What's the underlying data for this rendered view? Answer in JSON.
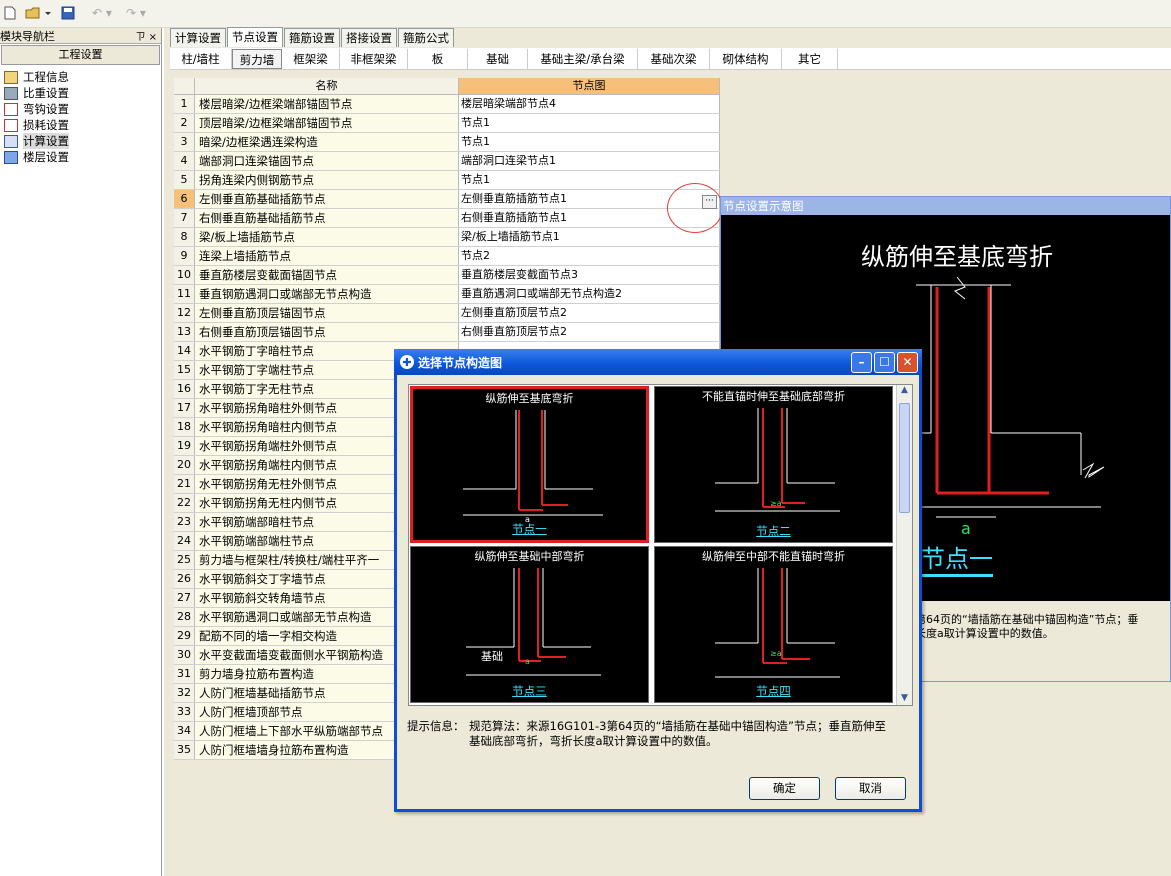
{
  "toolbar": {
    "icons": [
      "new-file-icon",
      "open-folder-icon",
      "save-icon",
      "undo-icon",
      "redo-icon"
    ]
  },
  "nav": {
    "title": "模块导航栏",
    "pin": "ㄗ ×",
    "section": "工程设置",
    "items": [
      {
        "label": "工程信息"
      },
      {
        "label": "比重设置"
      },
      {
        "label": "弯钩设置"
      },
      {
        "label": "损耗设置"
      },
      {
        "label": "计算设置"
      },
      {
        "label": "楼层设置"
      }
    ]
  },
  "tabs": [
    "计算设置",
    "节点设置",
    "箍筋设置",
    "搭接设置",
    "箍筋公式"
  ],
  "subtabs": [
    "柱/墙柱",
    "剪力墙",
    "框架梁",
    "非框架梁",
    "板",
    "基础",
    "基础主梁/承台梁",
    "基础次梁",
    "砌体结构",
    "其它"
  ],
  "grid": {
    "col_name": "名称",
    "col_value": "节点图",
    "rows": [
      {
        "n": "1",
        "name": "楼层暗梁/边框梁端部锚固节点",
        "value": "楼层暗梁端部节点4"
      },
      {
        "n": "2",
        "name": "顶层暗梁/边框梁端部锚固节点",
        "value": "节点1"
      },
      {
        "n": "3",
        "name": "暗梁/边框梁遇连梁构造",
        "value": "节点1"
      },
      {
        "n": "4",
        "name": "端部洞口连梁锚固节点",
        "value": "端部洞口连梁节点1"
      },
      {
        "n": "5",
        "name": "拐角连梁内侧钢筋节点",
        "value": "节点1"
      },
      {
        "n": "6",
        "name": "左侧垂直筋基础插筋节点",
        "value": "左侧垂直筋插筋节点1"
      },
      {
        "n": "7",
        "name": "右侧垂直筋基础插筋节点",
        "value": "右侧垂直筋插筋节点1"
      },
      {
        "n": "8",
        "name": "梁/板上墙插筋节点",
        "value": "梁/板上墙插筋节点1"
      },
      {
        "n": "9",
        "name": "连梁上墙插筋节点",
        "value": "节点2"
      },
      {
        "n": "10",
        "name": "垂直筋楼层变截面锚固节点",
        "value": "垂直筋楼层变截面节点3"
      },
      {
        "n": "11",
        "name": "垂直钢筋遇洞口或端部无节点构造",
        "value": "垂直筋遇洞口或端部无节点构造2"
      },
      {
        "n": "12",
        "name": "左侧垂直筋顶层锚固节点",
        "value": "左侧垂直筋顶层节点2"
      },
      {
        "n": "13",
        "name": "右侧垂直筋顶层锚固节点",
        "value": "右侧垂直筋顶层节点2"
      },
      {
        "n": "14",
        "name": "水平钢筋丁字暗柱节点",
        "value": ""
      },
      {
        "n": "15",
        "name": "水平钢筋丁字端柱节点",
        "value": ""
      },
      {
        "n": "16",
        "name": "水平钢筋丁字无柱节点",
        "value": ""
      },
      {
        "n": "17",
        "name": "水平钢筋拐角暗柱外侧节点",
        "value": ""
      },
      {
        "n": "18",
        "name": "水平钢筋拐角暗柱内侧节点",
        "value": ""
      },
      {
        "n": "19",
        "name": "水平钢筋拐角端柱外侧节点",
        "value": ""
      },
      {
        "n": "20",
        "name": "水平钢筋拐角端柱内侧节点",
        "value": ""
      },
      {
        "n": "21",
        "name": "水平钢筋拐角无柱外侧节点",
        "value": ""
      },
      {
        "n": "22",
        "name": "水平钢筋拐角无柱内侧节点",
        "value": ""
      },
      {
        "n": "23",
        "name": "水平钢筋端部暗柱节点",
        "value": ""
      },
      {
        "n": "24",
        "name": "水平钢筋端部端柱节点",
        "value": ""
      },
      {
        "n": "25",
        "name": "剪力墙与框架柱/转换柱/端柱平齐一",
        "value": ""
      },
      {
        "n": "26",
        "name": "水平钢筋斜交丁字墙节点",
        "value": ""
      },
      {
        "n": "27",
        "name": "水平钢筋斜交转角墙节点",
        "value": ""
      },
      {
        "n": "28",
        "name": "水平钢筋遇洞口或端部无节点构造",
        "value": ""
      },
      {
        "n": "29",
        "name": "配筋不同的墙一字相交构造",
        "value": ""
      },
      {
        "n": "30",
        "name": "水平变截面墙变截面侧水平钢筋构造",
        "value": ""
      },
      {
        "n": "31",
        "name": "剪力墙身拉筋布置构造",
        "value": ""
      },
      {
        "n": "32",
        "name": "人防门框墙基础插筋节点",
        "value": ""
      },
      {
        "n": "33",
        "name": "人防门框墙顶部节点",
        "value": ""
      },
      {
        "n": "34",
        "name": "人防门框墙上下部水平纵筋端部节点",
        "value": ""
      },
      {
        "n": "35",
        "name": "人防门框墙墙身拉筋布置构造",
        "value": ""
      }
    ],
    "ellipsis": "···"
  },
  "preview": {
    "title": "节点设置示意图",
    "heading": "纵筋伸至基底弯折",
    "dim": "a",
    "node_label": "节点一",
    "info_line1": "第64页的“墙插筋在基础中锚固构造”节点；垂",
    "info_line2": "长度a取计算设置中的数值。"
  },
  "dialog": {
    "title": "选择节点构造图",
    "thumbs": [
      {
        "title": "纵筋伸至基底弯折",
        "label": "节点一",
        "dim": "a"
      },
      {
        "title": "不能直锚时伸至基础底部弯折",
        "label": "节点二",
        "dim": "≥a"
      },
      {
        "title": "纵筋伸至基础中部弯折",
        "label": "节点三",
        "dim": "a",
        "base": "基础"
      },
      {
        "title": "纵筋伸至中部不能直锚时弯折",
        "label": "节点四",
        "dim": "≥a"
      }
    ],
    "hint_label": "提示信息：",
    "hint_text1": "规范算法：来源16G101-3第64页的“墙插筋在基础中锚固构造”节点；垂直筋伸至",
    "hint_text2": "基础底部弯折，弯折长度a取计算设置中的数值。",
    "ok": "确定",
    "cancel": "取消"
  },
  "colors": {
    "accent_red": "#e02020",
    "accent_cyan": "#3ae0ff",
    "selected_row": "#f6c07a",
    "title_blue": "#0a55da"
  }
}
